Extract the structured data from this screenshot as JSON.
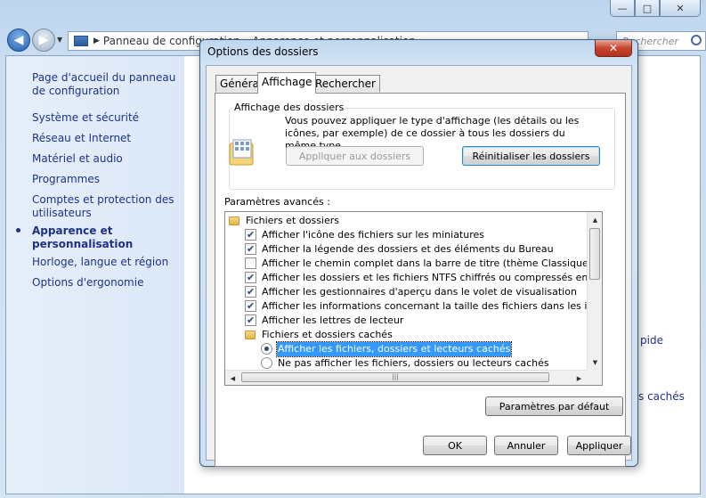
{
  "window": {
    "address_text": "Panneau de configuration ▸ Apparence et personnalisation",
    "search_placeholder": "Rechercher",
    "caption": {
      "minimize": "—",
      "maximize": "□",
      "close": "✕"
    }
  },
  "sidebar": {
    "items": [
      {
        "label": "Page d'accueil du panneau de configuration"
      },
      {
        "label": "Système et sécurité"
      },
      {
        "label": "Réseau et Internet"
      },
      {
        "label": "Matériel et audio"
      },
      {
        "label": "Programmes"
      },
      {
        "label": "Comptes et protection des utilisateurs"
      },
      {
        "label": "Apparence et personnalisation"
      },
      {
        "label": "Horloge, langue et région"
      },
      {
        "label": "Options d'ergonomie"
      }
    ]
  },
  "background_links": [
    "pide",
    "s cachés"
  ],
  "dialog": {
    "title": "Options des dossiers",
    "close": "✕",
    "tabs": [
      "Général",
      "Affichage",
      "Rechercher"
    ],
    "group_title": "Affichage des dossiers",
    "group_desc": "Vous pouvez appliquer le type d'affichage (les détails ou les icônes, par exemple) de ce dossier à tous les dossiers du même type.",
    "apply_folders": "Appliquer aux dossiers",
    "reset_folders": "Réinitialiser les dossiers",
    "advanced_label": "Paramètres avancés :",
    "tree": [
      {
        "type": "folder",
        "label": "Fichiers et dossiers",
        "indent": 0
      },
      {
        "type": "check",
        "checked": true,
        "label": "Afficher l'icône des fichiers sur les miniatures",
        "indent": 1
      },
      {
        "type": "check",
        "checked": true,
        "label": "Afficher la légende des dossiers et des éléments du Bureau",
        "indent": 1
      },
      {
        "type": "check",
        "checked": false,
        "label": "Afficher le chemin complet dans la barre de titre (thème Classique uniquement)",
        "indent": 1
      },
      {
        "type": "check",
        "checked": true,
        "label": "Afficher les dossiers et les fichiers NTFS chiffrés ou compressés en couleur",
        "indent": 1
      },
      {
        "type": "check",
        "checked": true,
        "label": "Afficher les gestionnaires d'aperçu dans le volet de visualisation",
        "indent": 1
      },
      {
        "type": "check",
        "checked": true,
        "label": "Afficher les informations concernant la taille des fichiers dans les info-bulles du do",
        "indent": 1
      },
      {
        "type": "check",
        "checked": true,
        "label": "Afficher les lettres de lecteur",
        "indent": 1
      },
      {
        "type": "folder",
        "label": "Fichiers et dossiers cachés",
        "indent": 1
      },
      {
        "type": "radio",
        "checked": true,
        "selected": true,
        "label": "Afficher les fichiers, dossiers et lecteurs cachés",
        "indent": 2
      },
      {
        "type": "radio",
        "checked": false,
        "label": "Ne pas afficher les fichiers, dossiers ou lecteurs cachés",
        "indent": 2
      }
    ],
    "defaults_btn": "Paramètres par défaut",
    "ok": "OK",
    "cancel": "Annuler",
    "apply": "Appliquer"
  }
}
